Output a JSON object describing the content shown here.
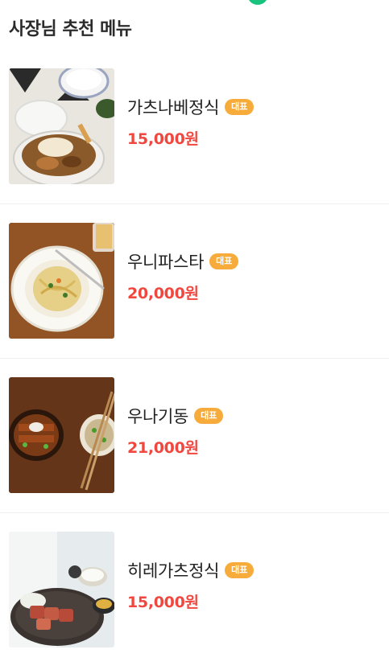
{
  "section": {
    "title": "사장님 추천 메뉴"
  },
  "menu": [
    {
      "name": "가츠나베정식",
      "badge": "대표",
      "price": "15,000원",
      "image": "katsunabe-photo"
    },
    {
      "name": "우니파스타",
      "badge": "대표",
      "price": "20,000원",
      "image": "uni-pasta-photo"
    },
    {
      "name": "우나기동",
      "badge": "대표",
      "price": "21,000원",
      "image": "unagi-don-photo"
    },
    {
      "name": "히레가츠정식",
      "badge": "대표",
      "price": "15,000원",
      "image": "hirekatsu-photo"
    }
  ],
  "colors": {
    "price": "#f0473e",
    "badge": "#f6ab3b",
    "accent": "#19c37d"
  }
}
